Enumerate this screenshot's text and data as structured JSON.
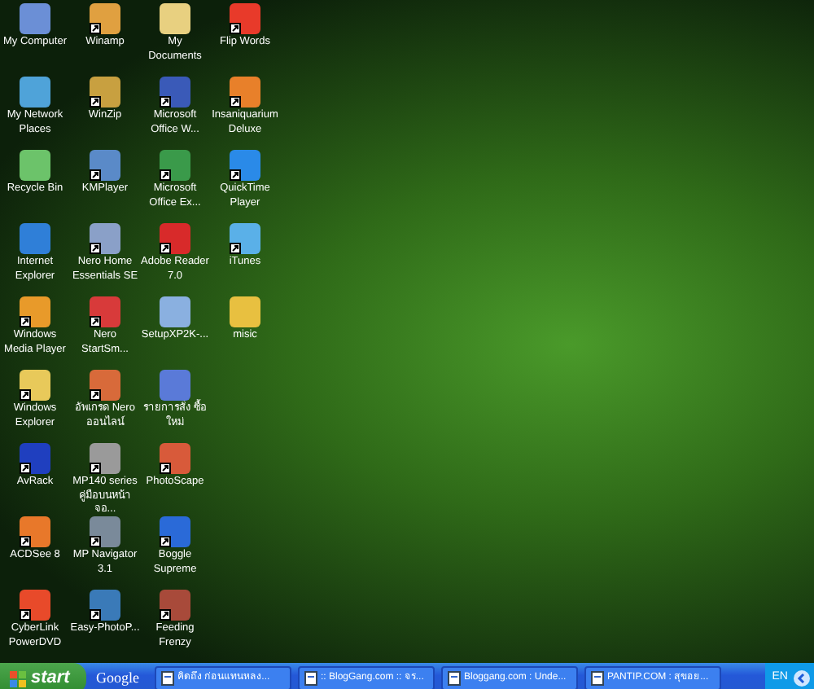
{
  "desktop": {
    "columns": [
      {
        "icons": [
          {
            "label": "My Computer",
            "shortcut": false,
            "color": "#6b8fd6"
          },
          {
            "label": "My Network Places",
            "shortcut": false,
            "color": "#4fa3d9"
          },
          {
            "label": "Recycle Bin",
            "shortcut": false,
            "color": "#6cc36a"
          },
          {
            "label": "Internet Explorer",
            "shortcut": false,
            "color": "#2f7fd8"
          },
          {
            "label": "Windows Media Player",
            "shortcut": true,
            "color": "#e89a2a"
          },
          {
            "label": "Windows Explorer",
            "shortcut": true,
            "color": "#e8c95a"
          },
          {
            "label": "AvRack",
            "shortcut": true,
            "color": "#1f3fbf"
          },
          {
            "label": "ACDSee 8",
            "shortcut": true,
            "color": "#e8782a"
          },
          {
            "label": "CyberLink PowerDVD",
            "shortcut": true,
            "color": "#e84a2a"
          }
        ]
      },
      {
        "icons": [
          {
            "label": "Winamp",
            "shortcut": true,
            "color": "#e0a040"
          },
          {
            "label": "WinZip",
            "shortcut": true,
            "color": "#c8a040"
          },
          {
            "label": "KMPlayer",
            "shortcut": true,
            "color": "#5a8ac8"
          },
          {
            "label": "Nero Home Essentials SE",
            "shortcut": true,
            "color": "#8aa0c8"
          },
          {
            "label": "Nero StartSm...",
            "shortcut": true,
            "color": "#d83a3a"
          },
          {
            "label": "อัพเกรด Nero ออนไลน์",
            "shortcut": true,
            "color": "#d86a3a"
          },
          {
            "label": "MP140 series คู่มือบนหน้าจอ...",
            "shortcut": true,
            "color": "#9a9a9a"
          },
          {
            "label": "MP Navigator 3.1",
            "shortcut": true,
            "color": "#7a8a9a"
          },
          {
            "label": "Easy-PhotoP...",
            "shortcut": true,
            "color": "#3a7ab8"
          }
        ]
      },
      {
        "icons": [
          {
            "label": "My Documents",
            "shortcut": false,
            "color": "#e8d080"
          },
          {
            "label": "Microsoft Office W...",
            "shortcut": true,
            "color": "#3a5ab8"
          },
          {
            "label": "Microsoft Office Ex...",
            "shortcut": true,
            "color": "#3a9a4a"
          },
          {
            "label": "Adobe Reader 7.0",
            "shortcut": true,
            "color": "#d82a2a"
          },
          {
            "label": "SetupXP2K-...",
            "shortcut": false,
            "color": "#8ab0e0"
          },
          {
            "label": "รายการสั่ง ซื้อใหม่",
            "shortcut": false,
            "color": "#5a7ad8"
          },
          {
            "label": "PhotoScape",
            "shortcut": true,
            "color": "#d85a3a"
          },
          {
            "label": "Boggle Supreme",
            "shortcut": true,
            "color": "#2a6ad8"
          },
          {
            "label": "Feeding Frenzy",
            "shortcut": true,
            "color": "#a84a3a"
          }
        ]
      },
      {
        "icons": [
          {
            "label": "Flip Words",
            "shortcut": true,
            "color": "#e83a2a"
          },
          {
            "label": "Insaniquarium Deluxe",
            "shortcut": true,
            "color": "#e8802a"
          },
          {
            "label": "QuickTime Player",
            "shortcut": true,
            "color": "#2a8ae8"
          },
          {
            "label": "iTunes",
            "shortcut": true,
            "color": "#5ab0e8"
          },
          {
            "label": "misic",
            "shortcut": false,
            "color": "#e8c040"
          }
        ]
      }
    ]
  },
  "taskbar": {
    "start": "start",
    "toolbar": "Google",
    "tasks": [
      {
        "label": "คิดถึง ก่อนแทนหลง..."
      },
      {
        "label": ":: BlogGang.com :: จร..."
      },
      {
        "label": "Bloggang.com : Unde..."
      },
      {
        "label": "PANTIP.COM : สุขอย..."
      }
    ],
    "language": "EN"
  }
}
